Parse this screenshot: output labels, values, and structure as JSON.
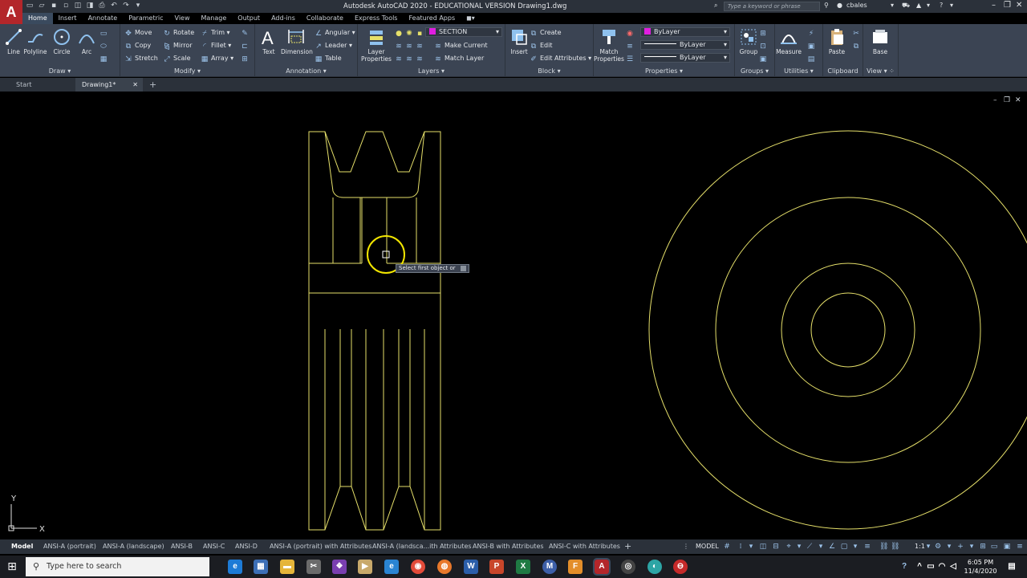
{
  "title_bar": {
    "logo": "A",
    "title": "Autodesk AutoCAD 2020 - EDUCATIONAL VERSION    Drawing1.dwg",
    "search_placeholder": "Type a keyword or phrase",
    "user": "cbales"
  },
  "ribbon_tabs": [
    "Home",
    "Insert",
    "Annotate",
    "Parametric",
    "View",
    "Manage",
    "Output",
    "Add-ins",
    "Collaborate",
    "Express Tools",
    "Featured Apps"
  ],
  "ribbon": {
    "draw": {
      "title": "Draw",
      "line": "Line",
      "polyline": "Polyline",
      "circle": "Circle",
      "arc": "Arc"
    },
    "modify": {
      "title": "Modify",
      "move": "Move",
      "rotate": "Rotate",
      "trim": "Trim",
      "copy": "Copy",
      "mirror": "Mirror",
      "fillet": "Fillet",
      "stretch": "Stretch",
      "scale": "Scale",
      "array": "Array"
    },
    "annotation": {
      "title": "Annotation",
      "text": "Text",
      "dimension": "Dimension",
      "angular": "Angular",
      "leader": "Leader",
      "table": "Table"
    },
    "layers": {
      "title": "Layers",
      "layer_properties": "Layer Properties",
      "current_layer": "SECTION",
      "make_current": "Make Current",
      "match_layer": "Match Layer"
    },
    "block": {
      "title": "Block",
      "insert": "Insert",
      "create": "Create",
      "edit": "Edit",
      "edit_attributes": "Edit Attributes"
    },
    "properties": {
      "title": "Properties",
      "match_properties": "Match Properties",
      "color": "ByLayer",
      "linetype": "ByLayer",
      "lineweight": "ByLayer"
    },
    "groups": {
      "title": "Groups",
      "group": "Group"
    },
    "utilities": {
      "title": "Utilities",
      "measure": "Measure"
    },
    "clipboard": {
      "title": "Clipboard",
      "paste": "Paste"
    },
    "view": {
      "title": "View",
      "base": "Base"
    }
  },
  "doc_tabs": {
    "start": "Start",
    "drawing": "Drawing1*"
  },
  "canvas": {
    "tooltip": "Select first object or",
    "ucs_y": "Y",
    "ucs_x": "X"
  },
  "layout_tabs": [
    "Model",
    "ANSI-A (portrait)",
    "ANSI-A (landscape)",
    "ANSI-B",
    "ANSI-C",
    "ANSI-D",
    "ANSI-A (portrait) with Attributes",
    "ANSI-A (landsca...ith Attributes",
    "ANSI-B with Attributes",
    "ANSI-C with Attributes"
  ],
  "status": {
    "mode": "MODEL",
    "scale": "1:1"
  },
  "taskbar": {
    "search_placeholder": "Type here to search",
    "time": "6:05 PM",
    "date": "11/4/2020"
  },
  "colors": {
    "drawing_line": "#e6e06a",
    "accent": "#b3262a",
    "layer_color": "#e01ee0"
  }
}
